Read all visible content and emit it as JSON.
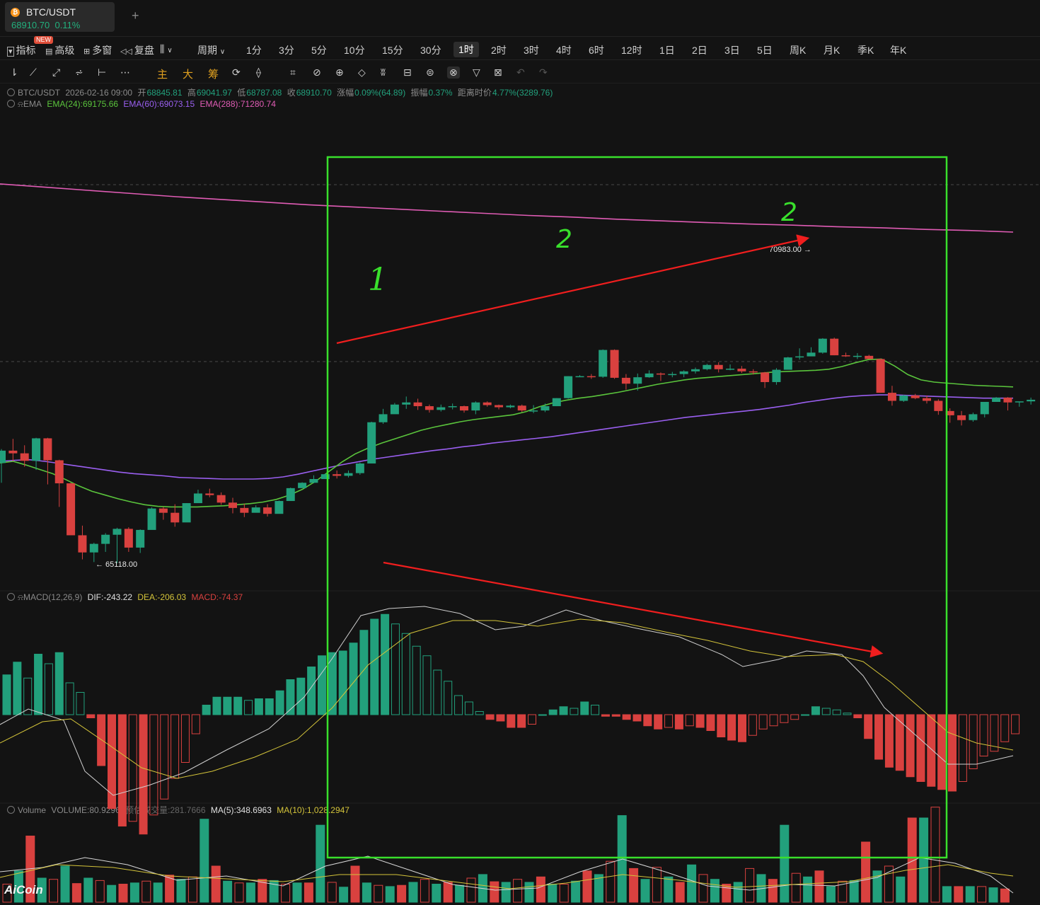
{
  "tab": {
    "symbol": "BTC/USDT",
    "price": "68910.70",
    "change": "0.11%",
    "add_label": "+"
  },
  "menu": {
    "new_badge": "NEW",
    "left": [
      "指标",
      "高级",
      "多窗",
      "复盘"
    ],
    "period_label": "周期",
    "periods": [
      "1分",
      "3分",
      "5分",
      "10分",
      "15分",
      "30分",
      "1时",
      "2时",
      "3时",
      "4时",
      "6时",
      "12时",
      "1日",
      "2日",
      "3日",
      "5日",
      "周K",
      "月K",
      "季K",
      "年K"
    ],
    "active_period": "1时"
  },
  "toolbar": {
    "labels": [
      "主",
      "大",
      "筹"
    ]
  },
  "ohlc": {
    "symbol": "BTC/USDT",
    "time": "2026-02-16 09:00",
    "open_label": "开",
    "open": "68845.81",
    "high_label": "高",
    "high": "69041.97",
    "low_label": "低",
    "low": "68787.08",
    "close_label": "收",
    "close": "68910.70",
    "change_label": "涨幅",
    "change": "0.09%(64.89)",
    "amp_label": "振幅",
    "amp": "0.37%",
    "dist_label": "距离时价",
    "dist": "4.77%(3289.76)"
  },
  "ema": {
    "label": "EMA",
    "ema24": "EMA(24):69175.66",
    "ema60": "EMA(60):69073.15",
    "ema288": "EMA(288):71280.74"
  },
  "macd": {
    "label": "MACD(12,26,9)",
    "dif": "DIF:-243.22",
    "dea": "DEA:-206.03",
    "macd": "MACD:-74.37"
  },
  "volume": {
    "label": "Volume",
    "vol": "VOLUME:80.9296",
    "est": "预估成交量:281.7666",
    "ma5": "MA(5):348.6963",
    "ma10": "MA(10):1,028.2947"
  },
  "logo": "AiCoin",
  "colors": {
    "up": "#22a07c",
    "down": "#d9413f",
    "ema24": "#5ac43c",
    "ema60": "#9a5ff0",
    "ema288": "#e05cb5",
    "annotation_box": "#39e02c",
    "arrow": "#f01e1e",
    "dif": "#cfcfcf",
    "dea": "#d4c43a"
  },
  "chart_data": {
    "type": "candlestick",
    "annotations": {
      "high_label": "70983.00",
      "low_label": "65118.00",
      "marks": [
        "1",
        "2",
        "2"
      ]
    },
    "candles": [
      [
        66990,
        67220,
        66620,
        67250
      ],
      [
        67220,
        67170,
        67020,
        67440
      ],
      [
        67170,
        67030,
        66920,
        67320
      ],
      [
        67030,
        67450,
        66860,
        67460
      ],
      [
        67450,
        67040,
        66590,
        67460
      ],
      [
        67040,
        66610,
        66170,
        67050
      ],
      [
        66610,
        65640,
        65650,
        66620
      ],
      [
        65640,
        65320,
        65190,
        65820
      ],
      [
        65320,
        65480,
        65140,
        65500
      ],
      [
        65480,
        65650,
        65330,
        65680
      ],
      [
        65650,
        65760,
        65120,
        65780
      ],
      [
        65760,
        65410,
        65330,
        65790
      ],
      [
        65410,
        65740,
        65310,
        65750
      ],
      [
        65740,
        66140,
        65810,
        66160
      ],
      [
        66140,
        66060,
        65930,
        66170
      ],
      [
        66060,
        65880,
        65800,
        66220
      ],
      [
        65880,
        66240,
        65890,
        66240
      ],
      [
        66240,
        66420,
        66270,
        66490
      ],
      [
        66420,
        66390,
        66350,
        66510
      ],
      [
        66390,
        66250,
        66210,
        66440
      ],
      [
        66250,
        66150,
        66050,
        66340
      ],
      [
        66150,
        66060,
        65980,
        66230
      ],
      [
        66060,
        66160,
        66080,
        66200
      ],
      [
        66160,
        66040,
        65990,
        66220
      ],
      [
        66040,
        66280,
        66080,
        66290
      ],
      [
        66280,
        66520,
        66290,
        66530
      ],
      [
        66520,
        66620,
        66540,
        66630
      ],
      [
        66620,
        66690,
        66610,
        66760
      ],
      [
        66690,
        66780,
        66700,
        66790
      ],
      [
        66780,
        66750,
        66700,
        66850
      ],
      [
        66750,
        66800,
        66720,
        66850
      ],
      [
        66800,
        66980,
        66770,
        67000
      ],
      [
        66980,
        67750,
        67100,
        67760
      ],
      [
        67750,
        67900,
        67720,
        68000
      ],
      [
        67900,
        68080,
        67960,
        68110
      ],
      [
        68080,
        68120,
        68000,
        68230
      ],
      [
        68120,
        68050,
        67980,
        68190
      ],
      [
        68050,
        67980,
        67930,
        68080
      ],
      [
        67980,
        68030,
        67950,
        68080
      ],
      [
        68030,
        68050,
        67990,
        68100
      ],
      [
        68050,
        67970,
        67930,
        68060
      ],
      [
        67970,
        68120,
        67900,
        68140
      ],
      [
        68120,
        68070,
        68040,
        68140
      ],
      [
        68070,
        68030,
        67990,
        68080
      ],
      [
        68030,
        68060,
        68010,
        68080
      ],
      [
        68060,
        67970,
        67940,
        68080
      ],
      [
        67970,
        67970,
        67920,
        68070
      ],
      [
        67970,
        68050,
        67940,
        68100
      ],
      [
        68050,
        68200,
        68050,
        68200
      ],
      [
        68200,
        68610,
        68190,
        68610
      ],
      [
        68610,
        68610,
        68600,
        68630
      ],
      [
        68610,
        68600,
        68560,
        68650
      ],
      [
        68600,
        69100,
        68580,
        69110
      ],
      [
        69100,
        68580,
        68560,
        69110
      ],
      [
        68580,
        68470,
        68360,
        68650
      ],
      [
        68470,
        68590,
        68340,
        68660
      ],
      [
        68590,
        68660,
        68580,
        68720
      ],
      [
        68660,
        68640,
        68520,
        68680
      ],
      [
        68640,
        68650,
        68590,
        68690
      ],
      [
        68650,
        68700,
        68590,
        68720
      ],
      [
        68700,
        68740,
        68660,
        68770
      ],
      [
        68740,
        68820,
        68720,
        68840
      ],
      [
        68820,
        68740,
        68680,
        68870
      ],
      [
        68740,
        68750,
        68720,
        68830
      ],
      [
        68750,
        68700,
        68670,
        68800
      ],
      [
        68700,
        68680,
        68640,
        68740
      ],
      [
        68680,
        68500,
        68390,
        68690
      ],
      [
        68500,
        68730,
        68450,
        68760
      ],
      [
        68730,
        68960,
        68740,
        68970
      ],
      [
        68960,
        68980,
        68920,
        69130
      ],
      [
        68980,
        69050,
        68990,
        69150
      ],
      [
        69050,
        69310,
        69030,
        69320
      ],
      [
        69310,
        69000,
        69000,
        69330
      ],
      [
        69000,
        68990,
        68970,
        69050
      ],
      [
        68990,
        68990,
        68930,
        69040
      ],
      [
        68990,
        68930,
        68940,
        69010
      ],
      [
        68930,
        68300,
        68300,
        68940
      ],
      [
        68300,
        68150,
        68060,
        68430
      ],
      [
        68150,
        68250,
        68130,
        68260
      ],
      [
        68250,
        68200,
        68180,
        68280
      ],
      [
        68200,
        68150,
        68100,
        68250
      ],
      [
        68150,
        67960,
        67890,
        68180
      ],
      [
        67960,
        67880,
        67740,
        68010
      ],
      [
        67880,
        67790,
        67690,
        67960
      ],
      [
        67790,
        67900,
        67760,
        67930
      ],
      [
        67900,
        68130,
        67840,
        68130
      ],
      [
        68130,
        68210,
        68140,
        68220
      ],
      [
        68210,
        68120,
        67970,
        68220
      ],
      [
        68120,
        68140,
        68040,
        68130
      ],
      [
        68140,
        68170,
        68080,
        68210
      ]
    ],
    "ema24": [
      66990,
      67020,
      66950,
      66870,
      66790,
      66680,
      66560,
      66460,
      66390,
      66320,
      66260,
      66210,
      66180,
      66170,
      66170,
      66170,
      66180,
      66190,
      66210,
      66230,
      66260,
      66310,
      66390,
      66500,
      66650,
      66830,
      67010,
      67160,
      67270,
      67360,
      67440,
      67520,
      67600,
      67660,
      67710,
      67760,
      67800,
      67830,
      67860,
      67890,
      67950,
      68040,
      68110,
      68160,
      68200,
      68230,
      68270,
      68310,
      68360,
      68410,
      68460,
      68500,
      68540,
      68570,
      68590,
      68610,
      68630,
      68650,
      68670,
      68690,
      68700,
      68710,
      68720,
      68740,
      68790,
      68860,
      68920,
      68930,
      68800,
      68640,
      68540,
      68500,
      68480,
      68460,
      68440,
      68430,
      68420,
      68410
    ],
    "ema60": [
      67020,
      67040,
      67050,
      67020,
      66980,
      66940,
      66900,
      66860,
      66820,
      66790,
      66770,
      66750,
      66720,
      66710,
      66700,
      66690,
      66690,
      66690,
      66700,
      66730,
      66780,
      66840,
      66900,
      66960,
      67010,
      67060,
      67100,
      67140,
      67180,
      67220,
      67250,
      67290,
      67320,
      67360,
      67390,
      67420,
      67450,
      67480,
      67520,
      67560,
      67600,
      67640,
      67680,
      67720,
      67760,
      67800,
      67840,
      67870,
      67900,
      67930,
      67960,
      67990,
      68030,
      68070,
      68120,
      68160,
      68200,
      68230,
      68250,
      68260,
      68260,
      68250,
      68240,
      68230,
      68220,
      68210,
      68200,
      68200,
      68200
    ],
    "ema288": [
      72200,
      72140,
      72080,
      72020,
      71960,
      71910,
      71860,
      71810,
      71770,
      71730,
      71690,
      71650,
      71610,
      71580,
      71540,
      71510,
      71480,
      71450,
      71430,
      71400,
      71380,
      71350,
      71330,
      71300
    ],
    "macd_hist": [
      250,
      330,
      230,
      380,
      320,
      390,
      200,
      140,
      -20,
      -320,
      -590,
      -700,
      -670,
      -750,
      -630,
      -530,
      -400,
      -300,
      -120,
      60,
      110,
      110,
      110,
      90,
      100,
      100,
      150,
      220,
      230,
      300,
      370,
      390,
      400,
      450,
      530,
      600,
      630,
      570,
      510,
      430,
      370,
      280,
      210,
      120,
      80,
      20,
      -30,
      -40,
      -80,
      -80,
      -60,
      0,
      30,
      50,
      40,
      80,
      60,
      -10,
      -10,
      -30,
      -40,
      -70,
      -90,
      -80,
      -90,
      -70,
      -80,
      -100,
      -140,
      -160,
      -170,
      -130,
      -90,
      -70,
      -50,
      -30,
      0,
      50,
      40,
      30,
      10,
      -20,
      -150,
      -280,
      -330,
      -350,
      -390,
      -420,
      -450,
      -470,
      -480,
      -420,
      -340,
      -260,
      -230,
      -170,
      -120
    ],
    "dif_range": [
      -600,
      700
    ],
    "volume": [
      300,
      520,
      1100,
      400,
      380,
      600,
      310,
      400,
      360,
      280,
      300,
      320,
      350,
      320,
      450,
      380,
      420,
      1380,
      600,
      350,
      320,
      320,
      380,
      360,
      300,
      320,
      320,
      1280,
      330,
      250,
      600,
      320,
      280,
      260,
      280,
      330,
      380,
      300,
      330,
      280,
      400,
      460,
      340,
      330,
      380,
      330,
      420,
      300,
      300,
      350,
      520,
      460,
      680,
      1440,
      560,
      380,
      580,
      420,
      330,
      620,
      460,
      380,
      300,
      330,
      560,
      460,
      380,
      1280,
      480,
      420,
      520,
      260,
      350,
      360,
      1000,
      520,
      600,
      420,
      1400,
      1400,
      1580,
      260,
      260,
      260,
      260,
      240,
      220
    ]
  }
}
